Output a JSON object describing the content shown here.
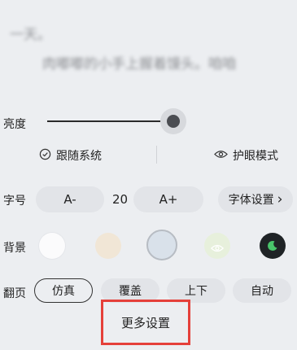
{
  "reader": {
    "line1": "一天。",
    "line2": "肉嘟嘟的小手上握着馒头。咱咱"
  },
  "brightness": {
    "label": "亮度",
    "level_fraction": 0.86,
    "follow_system": "跟随系统",
    "eye_protection": "护眼模式"
  },
  "font_size": {
    "label": "字号",
    "decrease": "A-",
    "value": "20",
    "increase": "A+",
    "settings": "字体设置",
    "settings_chevron": "›"
  },
  "background": {
    "label": "背景",
    "swatches": [
      {
        "name": "white",
        "color": "#fbfbfc"
      },
      {
        "name": "peach",
        "color": "#f1e6d6"
      },
      {
        "name": "light-blue",
        "color": "#d9e1ea"
      },
      {
        "name": "eye-green",
        "color": "#e7f0dc"
      },
      {
        "name": "night",
        "color": "#1f2326"
      }
    ]
  },
  "page_turn": {
    "label": "翻页",
    "options": [
      "仿真",
      "覆盖",
      "上下",
      "自动"
    ],
    "selected": "仿真"
  },
  "more_settings": "更多设置",
  "icons": {
    "check": "check-circle-icon",
    "eye": "eye-icon",
    "moon": "moon-icon"
  },
  "colors": {
    "highlight_border": "#e5403a",
    "panel_bg": "#eceef1",
    "pill_bg": "#e2e4e8"
  }
}
